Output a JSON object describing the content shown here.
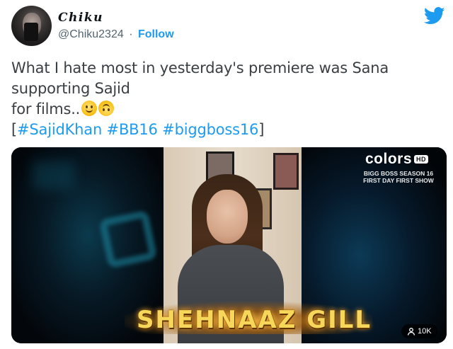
{
  "user": {
    "display_name": "Chiku",
    "handle": "@Chiku2324",
    "separator": "·",
    "follow_label": "Follow"
  },
  "tweet": {
    "line1": "What I hate most in yesterday's premiere was Sana",
    "line2": "supporting Sajid",
    "line3": "for films..",
    "emojis": [
      "slightly-smiling-face",
      "upside-down-face"
    ],
    "bracket_open": "[",
    "bracket_close": "]",
    "hashtags": [
      "#SajidKhan",
      "#BB16",
      "#biggboss16"
    ]
  },
  "media": {
    "channel_logo": "colors",
    "hd_badge": "HD",
    "caption": "BIGG BOSS SEASON 16 FIRST DAY FIRST SHOW",
    "name_banner": "SHEHNAAZ GILL",
    "views": "10K"
  },
  "colors": {
    "link_blue": "#1d9bf0",
    "text_gray": "#3a3f44",
    "banner_gold": "#f7d75a"
  },
  "icons": {
    "brand": "twitter-bird-icon",
    "views": "eye-icon"
  }
}
